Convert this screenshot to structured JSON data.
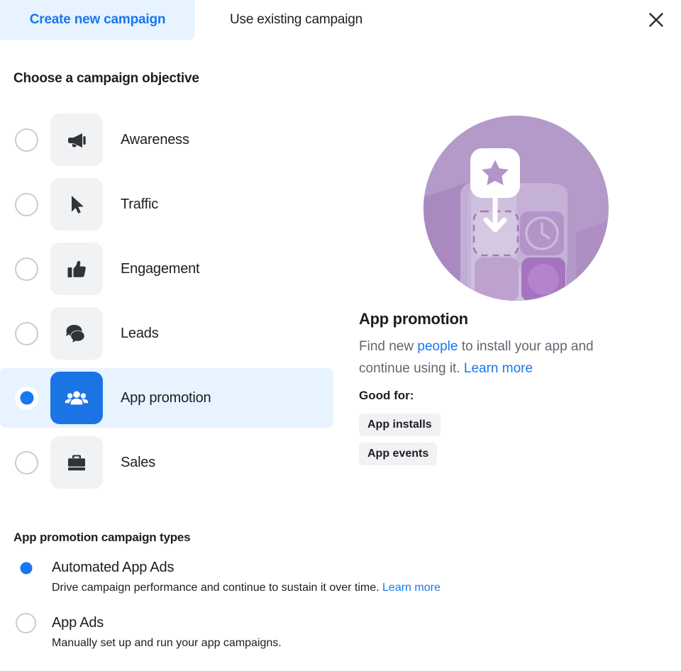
{
  "tabs": {
    "create_label": "Create new campaign",
    "existing_label": "Use existing campaign",
    "close_icon": "close-icon"
  },
  "objective_section": {
    "title": "Choose a campaign objective",
    "items": [
      {
        "label": "Awareness",
        "icon": "megaphone-icon",
        "selected": false
      },
      {
        "label": "Traffic",
        "icon": "cursor-icon",
        "selected": false
      },
      {
        "label": "Engagement",
        "icon": "thumbs-up-icon",
        "selected": false
      },
      {
        "label": "Leads",
        "icon": "chat-bubbles-icon",
        "selected": false
      },
      {
        "label": "App promotion",
        "icon": "people-group-icon",
        "selected": true
      },
      {
        "label": "Sales",
        "icon": "briefcase-icon",
        "selected": false
      }
    ]
  },
  "detail": {
    "title": "App promotion",
    "desc_part1": "Find new ",
    "desc_link1": "people",
    "desc_part2": " to install your app and continue using it. ",
    "desc_link2": "Learn more",
    "good_for_label": "Good for:",
    "badges": [
      "App installs",
      "App events"
    ]
  },
  "types_section": {
    "title": "App promotion campaign types",
    "items": [
      {
        "label": "Automated App Ads",
        "desc": "Drive campaign performance and continue to sustain it over time. ",
        "link": "Learn more",
        "selected": true
      },
      {
        "label": "App Ads",
        "desc": "Manually set up and run your app campaigns.",
        "link": "",
        "selected": false
      }
    ]
  },
  "colors": {
    "accent_blue": "#1877f2",
    "tile_blue": "#1b74e4",
    "selected_row_bg": "#e7f3ff",
    "tile_gray": "#f1f2f3",
    "text_gray": "#606770",
    "illustration_purple": "#b49ac8"
  }
}
